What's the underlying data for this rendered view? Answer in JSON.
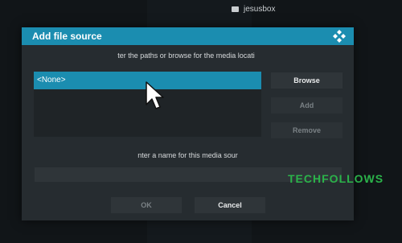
{
  "background": {
    "folder_label": "jesusbox"
  },
  "dialog": {
    "title": "Add file source",
    "instruction_paths": "ter the paths or browse for the media locati",
    "paths": [
      {
        "label": "<None>"
      }
    ],
    "buttons": {
      "browse": "Browse",
      "add": "Add",
      "remove": "Remove",
      "ok": "OK",
      "cancel": "Cancel"
    },
    "instruction_name": "nter a name for this media sour",
    "name_value": ""
  },
  "watermark": {
    "part1": "TECH",
    "part2": "FOLLOWS"
  },
  "colors": {
    "accent": "#1b8db0",
    "dialog_bg": "#262c30",
    "button_bg": "#2f3539",
    "watermark": "#2bb34a"
  }
}
